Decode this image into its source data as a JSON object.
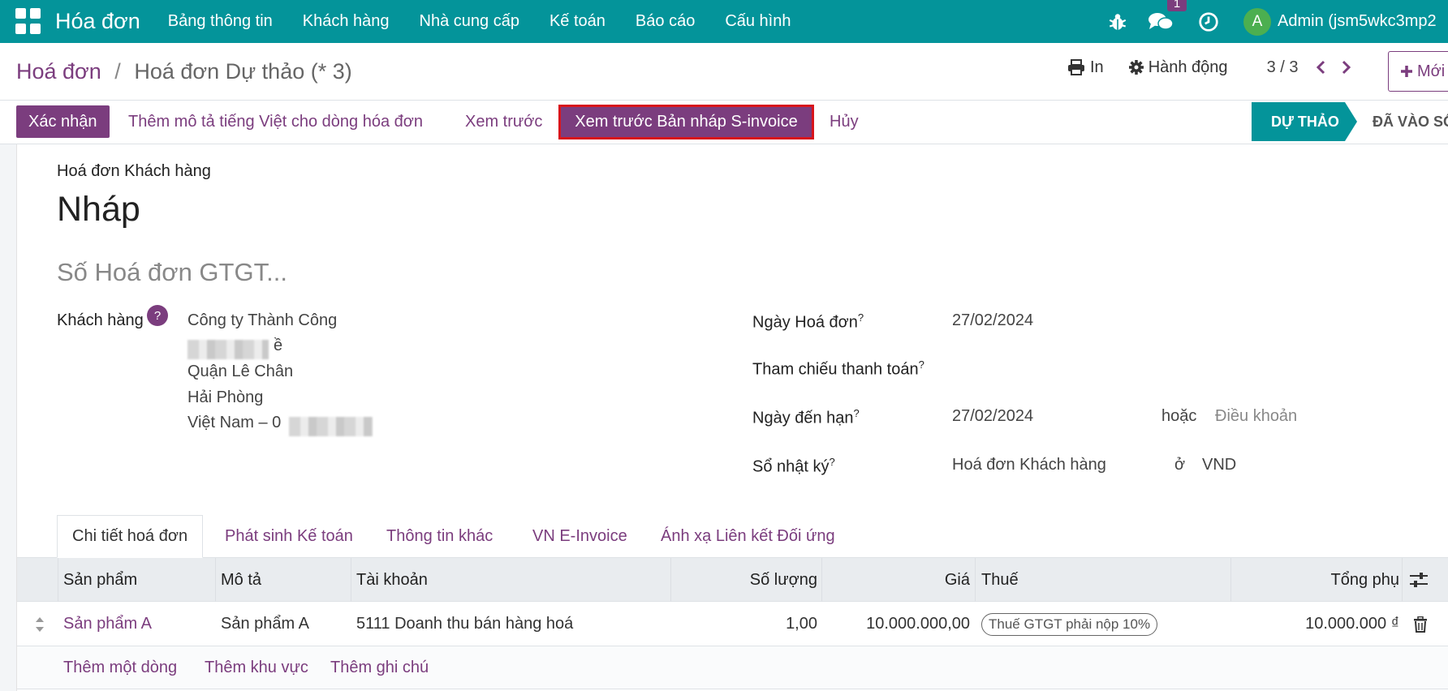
{
  "navbar": {
    "app_name": "Hóa đơn",
    "menu": [
      "Bảng thông tin",
      "Khách hàng",
      "Nhà cung cấp",
      "Kế toán",
      "Báo cáo",
      "Cấu hình"
    ],
    "chat_badge": "1",
    "avatar_letter": "A",
    "user": "Admin (jsm5wkc3mp2"
  },
  "control": {
    "breadcrumb_root": "Hoá đơn",
    "breadcrumb_sep": "/",
    "breadcrumb_current": "Hoá đơn Dự thảo (* 3)",
    "print": "In",
    "action": "Hành động",
    "pager": "3 / 3",
    "new": "Mới"
  },
  "actionbar": {
    "confirm": "Xác nhận",
    "add_vi_desc": "Thêm mô tả tiếng Việt cho dòng hóa đơn",
    "preview": "Xem trước",
    "preview_sinvoice": "Xem trước Bản nháp S-invoice",
    "cancel": "Hủy",
    "status_draft": "DỰ THẢO",
    "status_posted": "ĐÃ VÀO SỔ"
  },
  "form": {
    "move_type": "Hoá đơn Khách hàng",
    "title": "Nháp",
    "vat_placeholder": "Số Hoá đơn GTGT...",
    "customer_label": "Khách hàng",
    "help": "?",
    "customer_name": "Công ty Thành Công",
    "address_line2_tail": "ề",
    "address_district": "Quận Lê Chân",
    "address_city": "Hải Phòng",
    "address_country": "Việt Nam – 0",
    "invoice_date_label": "Ngày Hoá đơn",
    "invoice_date": "27/02/2024",
    "payment_ref_label": "Tham chiếu thanh toán",
    "due_date_label": "Ngày đến hạn",
    "due_date": "27/02/2024",
    "or_label": "hoặc",
    "terms_placeholder": "Điều khoản",
    "journal_label": "Sổ nhật ký",
    "journal": "Hoá đơn Khách hàng",
    "in_label": "ở",
    "currency": "VND",
    "sup": "?"
  },
  "tabs": [
    "Chi tiết hoá đơn",
    "Phát sinh Kế toán",
    "Thông tin khác",
    "VN E-Invoice",
    "Ánh xạ Liên kết Đối ứng"
  ],
  "table": {
    "headers": {
      "product": "Sản phẩm",
      "description": "Mô tả",
      "account": "Tài khoản",
      "quantity": "Số lượng",
      "price": "Giá",
      "tax": "Thuế",
      "subtotal": "Tổng phụ"
    },
    "rows": [
      {
        "product": "Sản phẩm A",
        "description": "Sản phẩm A",
        "account": "5111 Doanh thu bán hàng hoá",
        "quantity": "1,00",
        "price": "10.000.000,00",
        "tax": "Thuế GTGT phải nộp 10%",
        "subtotal": "10.000.000 ₫"
      }
    ],
    "add_line": "Thêm một dòng",
    "add_section": "Thêm khu vực",
    "add_note": "Thêm ghi chú"
  }
}
